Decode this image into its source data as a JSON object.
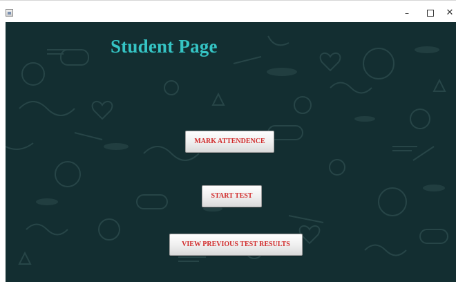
{
  "window": {
    "controls": {
      "minimize": "–",
      "close": "✕"
    }
  },
  "page": {
    "title": "Student Page",
    "background_color": "#132e31",
    "title_color": "#35c4c4",
    "button_text_color": "#d12a2a"
  },
  "buttons": {
    "mark_attendance": "MARK ATTENDENCE",
    "start_test": "START TEST",
    "view_results": "VIEW PREVIOUS TEST RESULTS"
  },
  "icons": {
    "app": "java-app-icon",
    "minimize": "minimize-icon",
    "maximize": "maximize-icon",
    "close": "close-icon"
  }
}
